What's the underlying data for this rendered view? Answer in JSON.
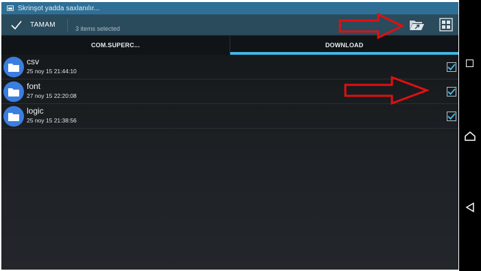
{
  "status_bar": {
    "notification_icon": "screenshot-icon",
    "notification_text": "Skrinşot yadda saxlanılır..."
  },
  "action_bar": {
    "done_label": "TAMAM",
    "selection_count": "3 items selected",
    "icons": [
      "check-icon",
      "move-folder-icon",
      "grid-view-icon"
    ]
  },
  "tabs": [
    {
      "label": "COM.SUPERC...",
      "active": false
    },
    {
      "label": "DOWNLOAD",
      "active": true
    }
  ],
  "files": [
    {
      "name": "csv",
      "date": "25 noy 15 21:44:10",
      "checked": true
    },
    {
      "name": "font",
      "date": "27 noy 15 22:20:08",
      "checked": true
    },
    {
      "name": "logic",
      "date": "25 noy 15 21:38:56",
      "checked": true
    }
  ],
  "nav_bar": {
    "icons": [
      "recent-apps-icon",
      "home-icon",
      "back-icon"
    ]
  },
  "colors": {
    "status_bar": "#2f6f96",
    "action_bar": "#2a4b5c",
    "tab_indicator": "#43b7e5",
    "folder_icon": "#3c7ee0",
    "checkmark": "#43b7e5",
    "annotation_arrow": "#e01010"
  }
}
